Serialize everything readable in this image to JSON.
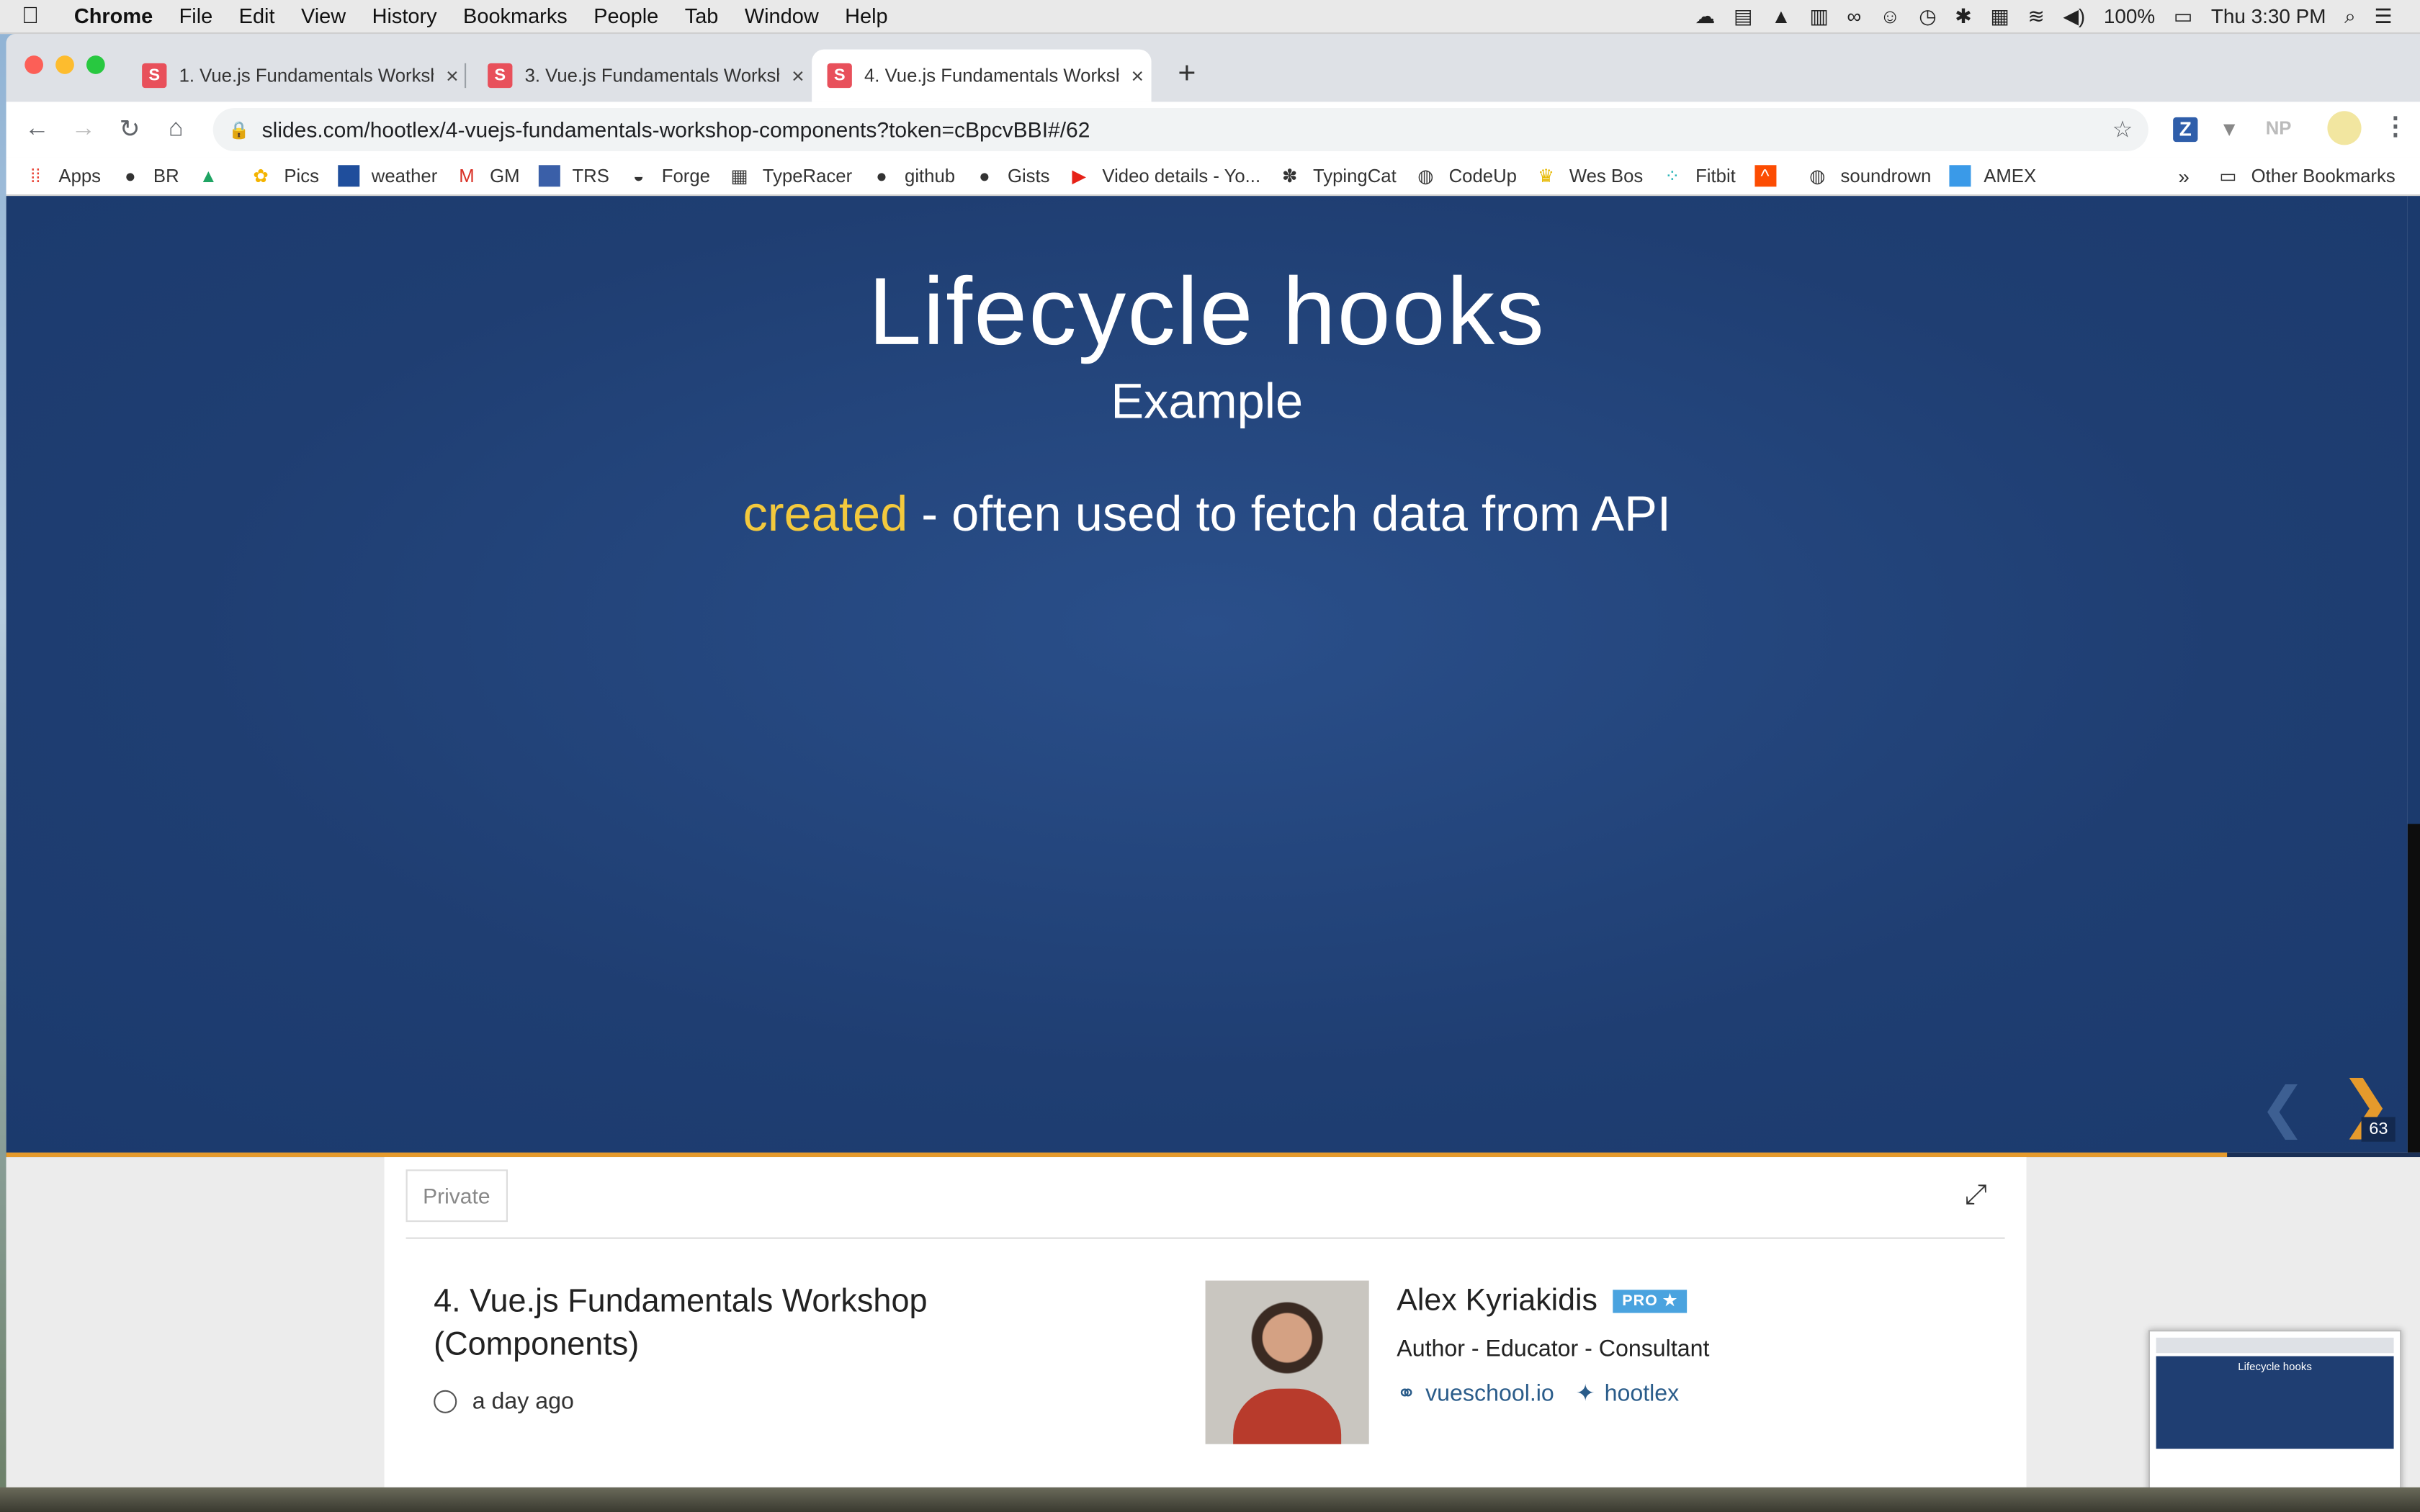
{
  "menubar": {
    "app": "Chrome",
    "items": [
      "File",
      "Edit",
      "View",
      "History",
      "Bookmarks",
      "People",
      "Tab",
      "Window",
      "Help"
    ],
    "battery": "100%",
    "clock": "Thu 3:30 PM"
  },
  "tabs": [
    {
      "title": "1. Vue.js Fundamentals Worksh",
      "favicon": "S"
    },
    {
      "title": "3. Vue.js Fundamentals Worksh",
      "favicon": "S"
    },
    {
      "title": "4. Vue.js Fundamentals Worksh",
      "favicon": "S"
    }
  ],
  "omnibox": {
    "url": "slides.com/hootlex/4-vuejs-fundamentals-workshop-components?token=cBpcvBBI#/62"
  },
  "bookmarks": [
    "Apps",
    "BR",
    "",
    "Pics",
    "weather",
    "GM",
    "TRS",
    "Forge",
    "TypeRacer",
    "github",
    "Gists",
    "Video details - Yo...",
    "TypingCat",
    "CodeUp",
    "Wes Bos",
    "Fitbit",
    "",
    "soundrown",
    "AMEX"
  ],
  "bookmarks_other": "Other Bookmarks",
  "slide": {
    "title": "Lifecycle hooks",
    "subtitle": "Example",
    "keyword": "created",
    "line_rest": " - often used to fetch data from API",
    "slide_number": "63",
    "progress": 0.92
  },
  "deck": {
    "visibility": "Private",
    "title": "4. Vue.js Fundamentals Workshop (Components)",
    "updated": "a day ago"
  },
  "author": {
    "name": "Alex Kyriakidis",
    "badge": "PRO ★",
    "role": "Author - Educator - Consultant",
    "website": "vueschool.io",
    "twitter": "hootlex"
  },
  "thumbnail": {
    "title": "Lifecycle hooks"
  },
  "colors": {
    "slide_bg": "#1f3e72",
    "accent": "#f3c93d",
    "progress": "#e59a2c",
    "link": "#2a5c8a"
  }
}
